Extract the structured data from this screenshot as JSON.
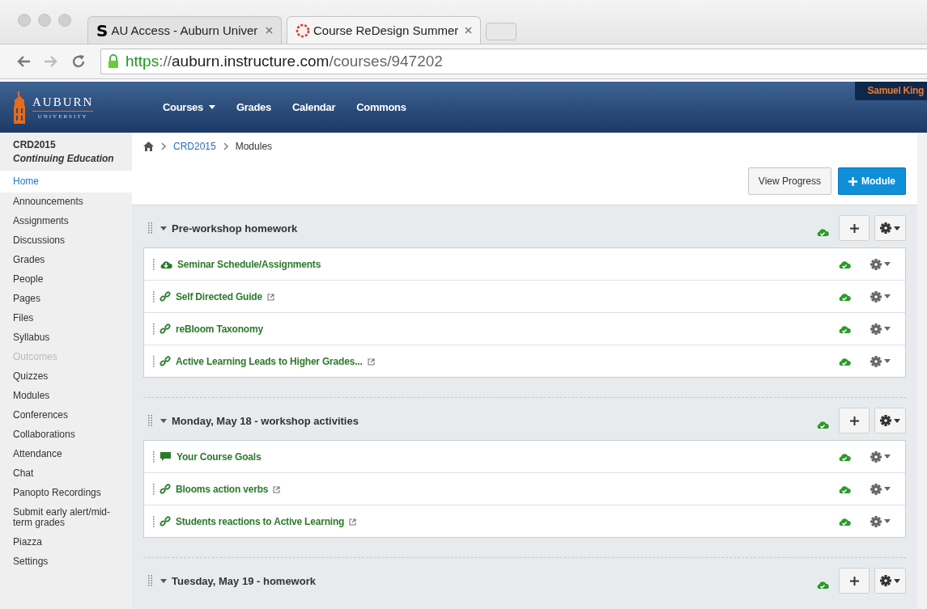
{
  "browser": {
    "tabs": [
      {
        "favicon_text": "S",
        "title": "AU Access - Auburn Univer",
        "selected": false
      },
      {
        "title": "Course ReDesign Summer",
        "selected": true
      }
    ],
    "url": {
      "scheme": "https",
      "separator": "://",
      "host": "auburn.instructure.com",
      "path": "/courses/947202"
    }
  },
  "header": {
    "logo": {
      "name": "AUBURN",
      "subtitle": "UNIVERSITY"
    },
    "nav": [
      {
        "label": "Courses",
        "dropdown": true
      },
      {
        "label": "Grades",
        "dropdown": false
      },
      {
        "label": "Calendar",
        "dropdown": false
      },
      {
        "label": "Commons",
        "dropdown": false
      }
    ],
    "user": "Samuel King"
  },
  "course": {
    "code": "CRD2015",
    "term": "Continuing Education"
  },
  "sidebar": {
    "items": [
      {
        "label": "Home",
        "selected": true,
        "disabled": false
      },
      {
        "label": "Announcements",
        "selected": false,
        "disabled": false
      },
      {
        "label": "Assignments",
        "selected": false,
        "disabled": false
      },
      {
        "label": "Discussions",
        "selected": false,
        "disabled": false
      },
      {
        "label": "Grades",
        "selected": false,
        "disabled": false
      },
      {
        "label": "People",
        "selected": false,
        "disabled": false
      },
      {
        "label": "Pages",
        "selected": false,
        "disabled": false
      },
      {
        "label": "Files",
        "selected": false,
        "disabled": false
      },
      {
        "label": "Syllabus",
        "selected": false,
        "disabled": false
      },
      {
        "label": "Outcomes",
        "selected": false,
        "disabled": true
      },
      {
        "label": "Quizzes",
        "selected": false,
        "disabled": false
      },
      {
        "label": "Modules",
        "selected": false,
        "disabled": false
      },
      {
        "label": "Conferences",
        "selected": false,
        "disabled": false
      },
      {
        "label": "Collaborations",
        "selected": false,
        "disabled": false
      },
      {
        "label": "Attendance",
        "selected": false,
        "disabled": false
      },
      {
        "label": "Chat",
        "selected": false,
        "disabled": false
      },
      {
        "label": "Panopto Recordings",
        "selected": false,
        "disabled": false
      },
      {
        "label": "Submit early alert/mid-term grades",
        "selected": false,
        "disabled": false
      },
      {
        "label": "Piazza",
        "selected": false,
        "disabled": false
      },
      {
        "label": "Settings",
        "selected": false,
        "disabled": false
      }
    ]
  },
  "breadcrumb": [
    "CRD2015",
    "Modules"
  ],
  "toolbar": {
    "view_progress": "View Progress",
    "add_module": "Module"
  },
  "modules": [
    {
      "title": "Pre-workshop homework",
      "expanded": true,
      "published": true,
      "items": [
        {
          "kind": "attachment",
          "title": "Seminar Schedule/Assignments",
          "external": false,
          "published": true
        },
        {
          "kind": "link",
          "title": "Self Directed Guide",
          "external": true,
          "published": true
        },
        {
          "kind": "link",
          "title": "reBloom Taxonomy",
          "external": false,
          "published": true
        },
        {
          "kind": "link",
          "title": "Active Learning Leads to Higher Grades...",
          "external": true,
          "published": true
        }
      ]
    },
    {
      "title": "Monday, May 18 - workshop activities",
      "expanded": true,
      "published": true,
      "items": [
        {
          "kind": "discussion",
          "title": "Your Course Goals",
          "external": false,
          "published": true
        },
        {
          "kind": "link",
          "title": "Blooms action verbs",
          "external": true,
          "published": true
        },
        {
          "kind": "link",
          "title": "Students reactions to Active Learning",
          "external": true,
          "published": true
        }
      ]
    },
    {
      "title": "Tuesday, May 19 - homework",
      "expanded": true,
      "published": true
    }
  ]
}
